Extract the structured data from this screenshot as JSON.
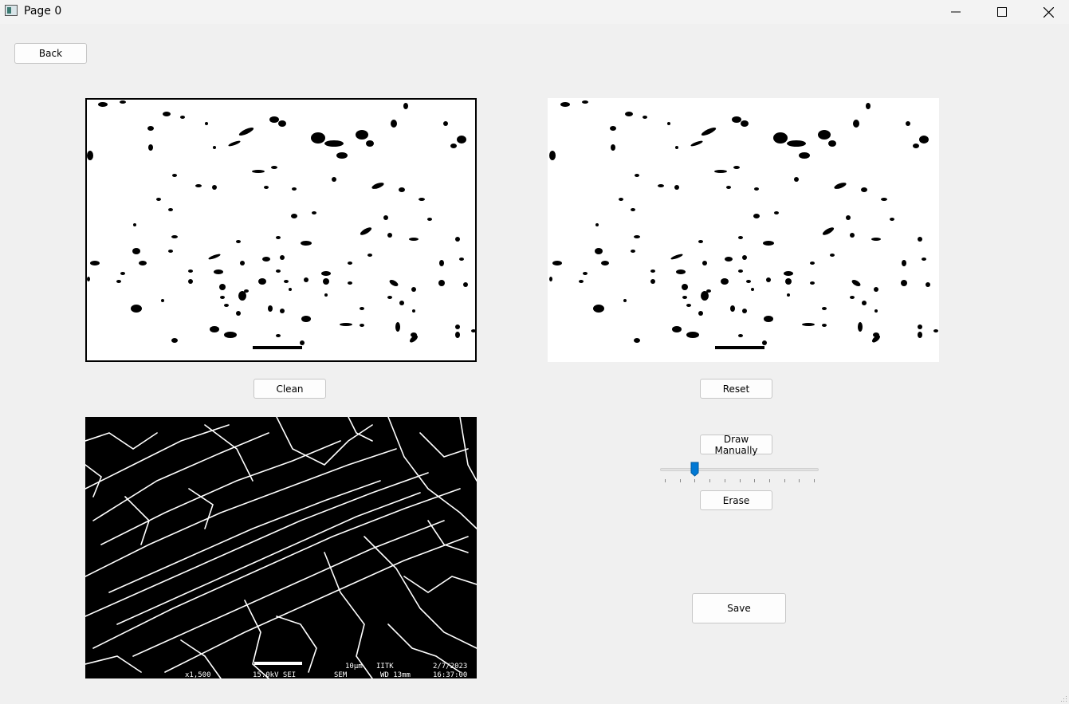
{
  "window": {
    "title": "Page 0"
  },
  "buttons": {
    "back": "Back",
    "clean": "Clean",
    "reset": "Reset",
    "draw_manually": "Draw Manually",
    "erase": "Erase",
    "save": "Save"
  },
  "slider": {
    "value": 2,
    "min": 0,
    "max": 10,
    "ticks": 11
  },
  "sem_caption": {
    "scale": "10μm",
    "org": "IITK",
    "date": "2/7/2023",
    "mag": "x1,500",
    "voltage": "15.0kV SEI",
    "mode": "SEM",
    "wd": "WD 13mm",
    "time": "16:37:00"
  },
  "colors": {
    "accent": "#0078d4"
  }
}
